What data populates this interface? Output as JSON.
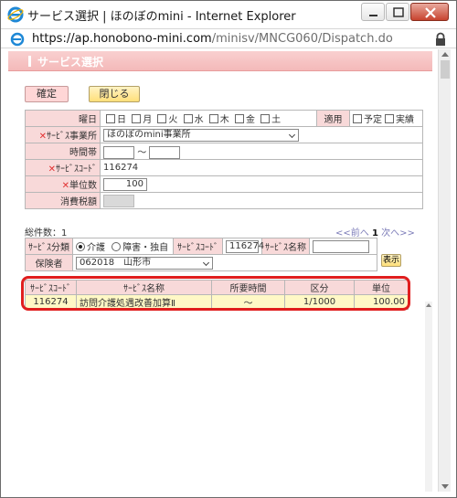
{
  "window": {
    "title": "サービス選択 | ほのぼのmini - Internet Explorer",
    "url_domain": "https://ap.honobono-mini.com",
    "url_path": "/minisv/MNCG060/Dispatch.do"
  },
  "page": {
    "section_title": "サービス選択",
    "buttons": {
      "confirm": "確定",
      "close": "閉じる"
    }
  },
  "form": {
    "weekday_label": "曜日",
    "weekdays": [
      "日",
      "月",
      "火",
      "水",
      "木",
      "金",
      "土"
    ],
    "apply_label": "適用",
    "apply_options": [
      "予定",
      "実績"
    ],
    "provider_label": "ｻｰﾋﾞｽ事業所",
    "provider_value": "ほのぼのmini事業所",
    "time_label": "時間帯",
    "time_separator": "～",
    "code_label": "ｻｰﾋﾞｽｺｰﾄﾞ",
    "code_value": "116274",
    "units_label": "単位数",
    "units_value": "100",
    "tax_label": "消費税額",
    "required_mark": "✕"
  },
  "search": {
    "total_text": "総件数：1",
    "pager": {
      "prev": "<<前へ",
      "current": "1",
      "next": "次へ>>"
    },
    "category_label": "ｻｰﾋﾞｽ分類",
    "category_options": [
      "介護",
      "障害・独自"
    ],
    "code_label": "ｻｰﾋﾞｽｺｰﾄﾞ",
    "code_value": "116274",
    "name_label": "ｻｰﾋﾞｽ名称",
    "name_value": "",
    "insurer_label": "保険者",
    "insurer_value": "062018　山形市",
    "show_button": "表示"
  },
  "results": {
    "columns": [
      "ｻｰﾋﾞｽｺｰﾄﾞ",
      "ｻｰﾋﾞｽ名称",
      "所要時間",
      "区分",
      "単位"
    ],
    "rows": [
      [
        "116274",
        "訪問介護処遇改善加算Ⅱ",
        "～",
        "1/1000",
        "100.00"
      ]
    ]
  }
}
